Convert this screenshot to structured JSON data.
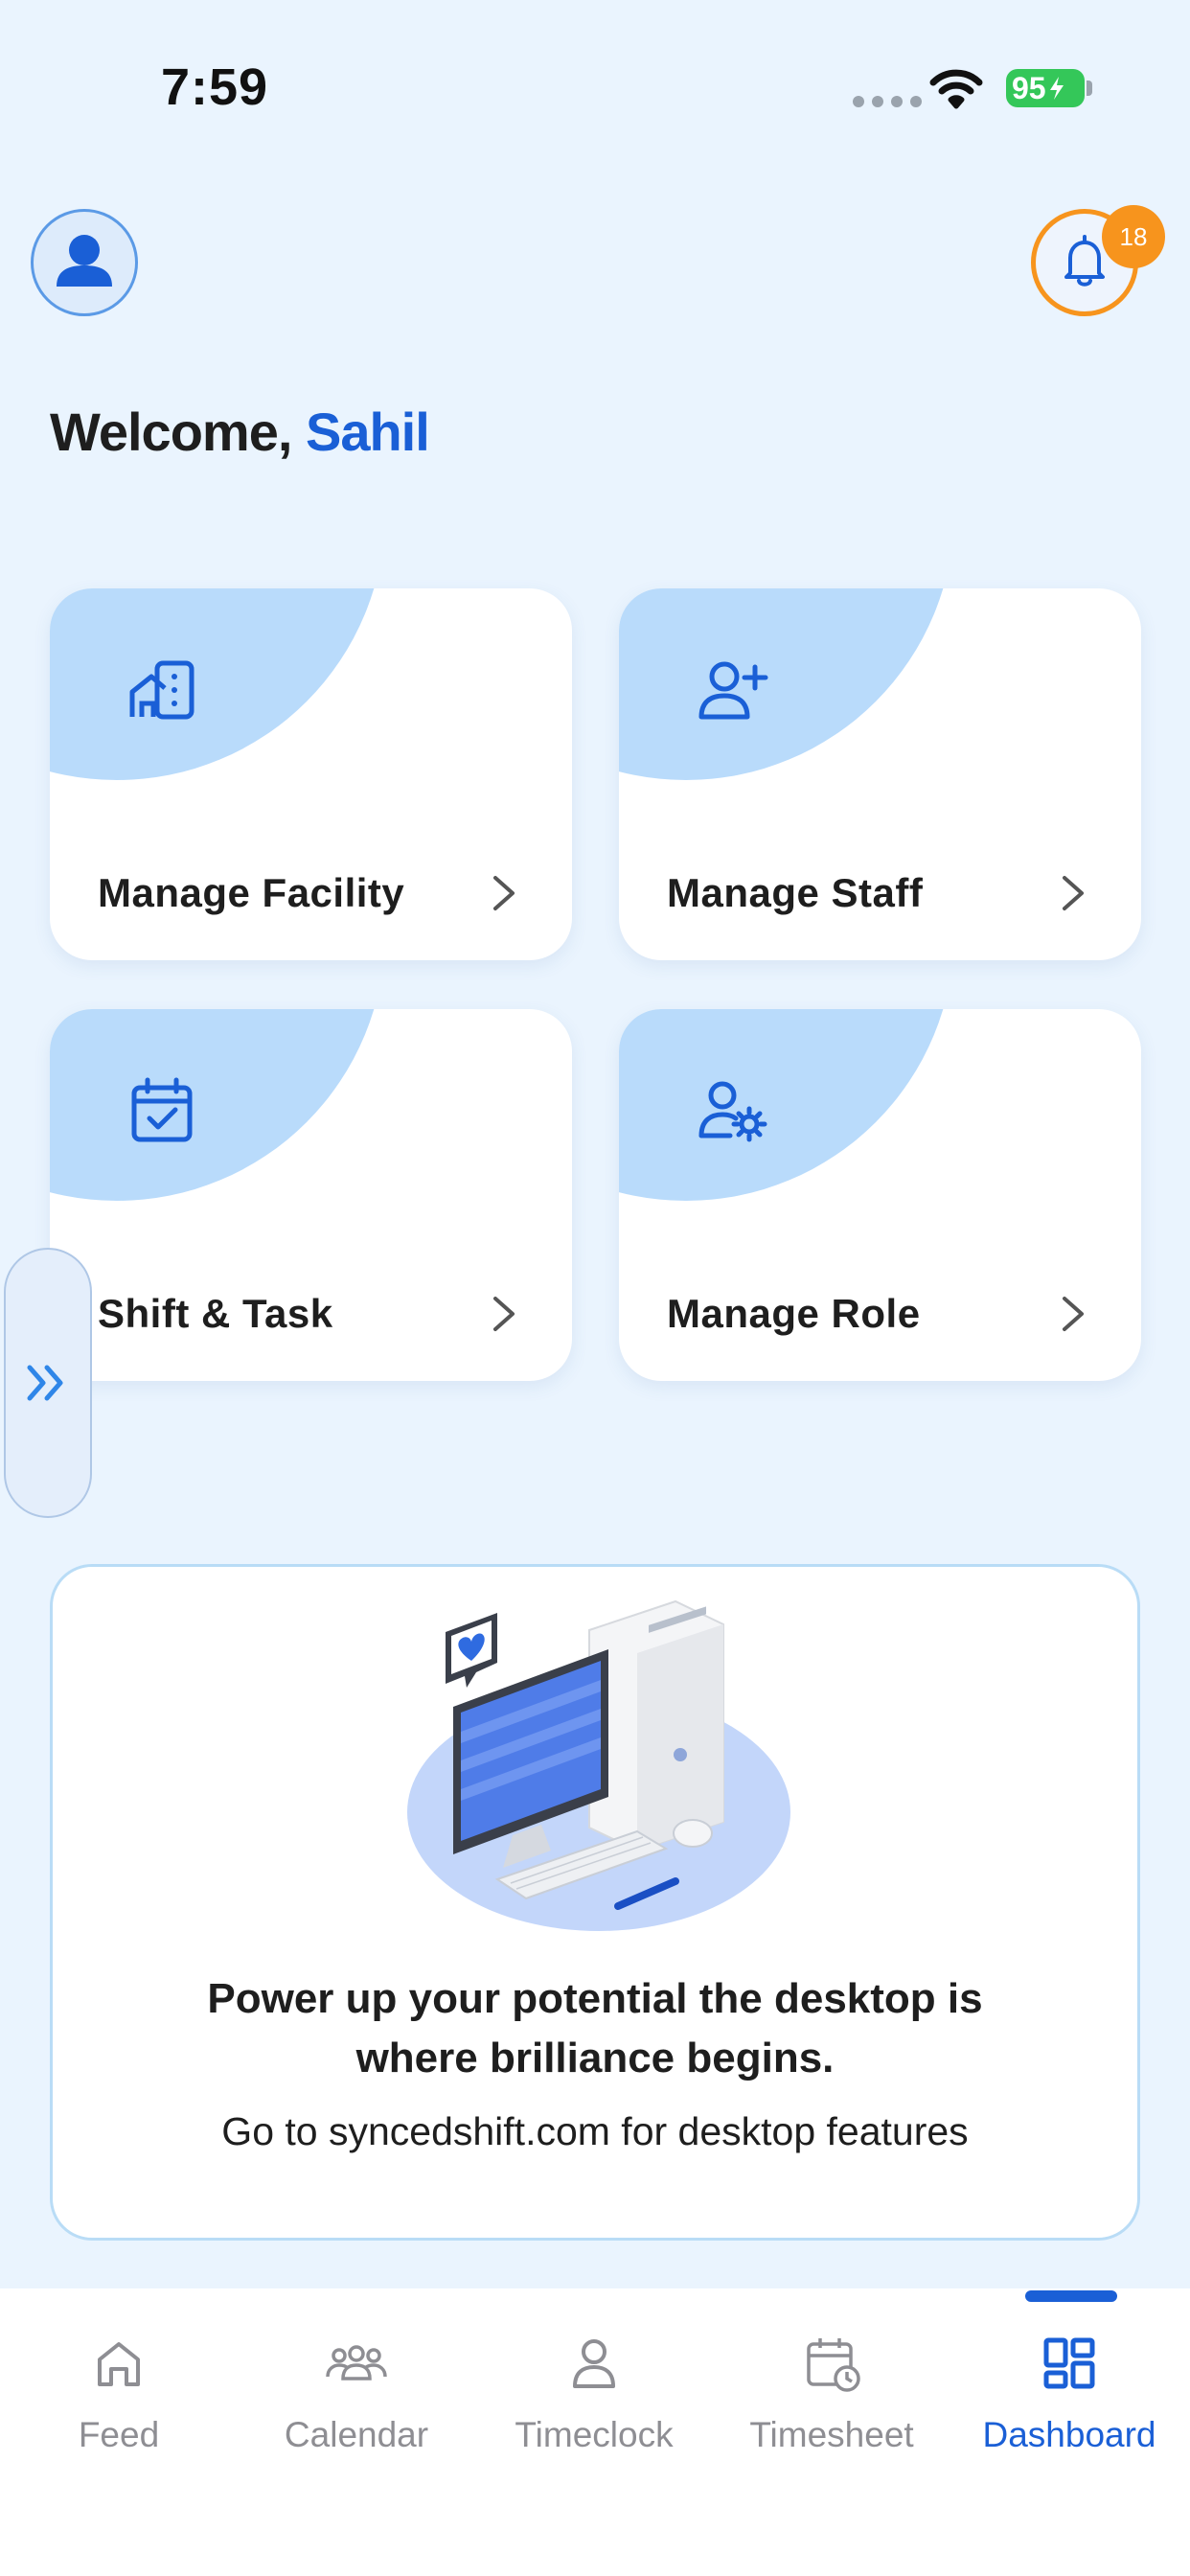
{
  "status_bar": {
    "time": "7:59",
    "battery": "95"
  },
  "header": {
    "notification_count": "18"
  },
  "welcome": {
    "greeting": "Welcome,",
    "name": "Sahil"
  },
  "tiles": [
    {
      "label": "Manage Facility",
      "icon": "building-icon"
    },
    {
      "label": "Manage Staff",
      "icon": "user-plus-icon"
    },
    {
      "label": "Shift & Task",
      "icon": "calendar-check-icon"
    },
    {
      "label": "Manage Role",
      "icon": "user-gear-icon"
    }
  ],
  "promo": {
    "title": "Power up your potential the desktop is where brilliance begins.",
    "subtitle": "Go to syncedshift.com for desktop features"
  },
  "nav": {
    "items": [
      {
        "label": "Feed",
        "icon": "home-icon"
      },
      {
        "label": "Calendar",
        "icon": "group-icon"
      },
      {
        "label": "Timeclock",
        "icon": "person-icon"
      },
      {
        "label": "Timesheet",
        "icon": "calendar-clock-icon"
      },
      {
        "label": "Dashboard",
        "icon": "dashboard-icon"
      }
    ],
    "active": "Dashboard"
  },
  "colors": {
    "accent": "#1A5FD6",
    "background": "#EAF4FE",
    "badge": "#F7941D",
    "tile_blob": "#B9DBFB"
  }
}
